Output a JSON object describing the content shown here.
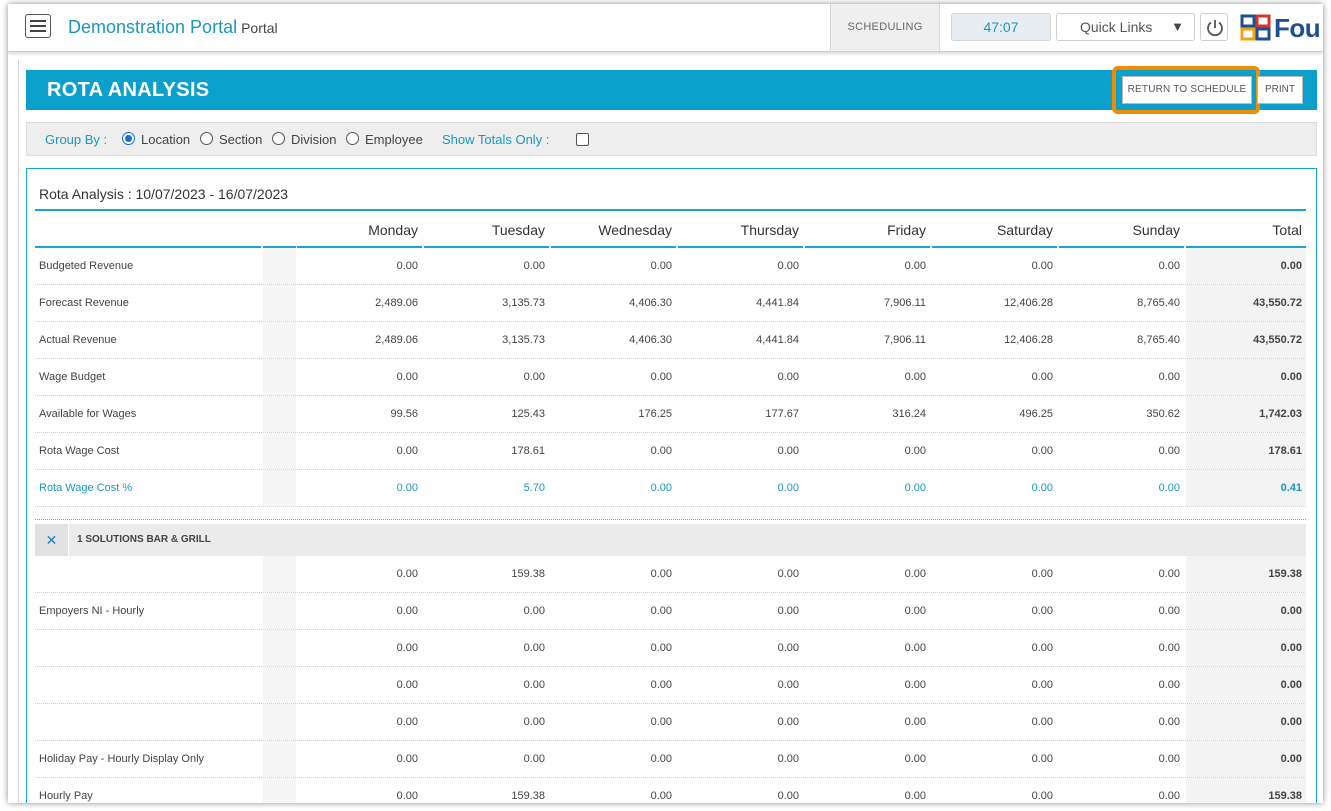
{
  "header": {
    "app_title": "Demonstration Portal",
    "app_subtitle": "Portal",
    "scheduling_tab": "SCHEDULING",
    "timer": "47:07",
    "quick_links": "Quick Links",
    "logo_text": "Fou"
  },
  "page": {
    "title": "ROTA ANALYSIS",
    "return_button": "RETURN TO SCHEDULE",
    "print_button": "PRINT",
    "highlight_color": "#f08c00"
  },
  "groupby": {
    "label": "Group By :",
    "options": [
      "Location",
      "Section",
      "Division",
      "Employee"
    ],
    "selected": "Location",
    "show_totals_label": "Show Totals Only :"
  },
  "report": {
    "title": "Rota Analysis : 10/07/2023 - 16/07/2023",
    "columns": [
      "Monday",
      "Tuesday",
      "Wednesday",
      "Thursday",
      "Friday",
      "Saturday",
      "Sunday",
      "Total"
    ],
    "summary_rows": [
      {
        "label": "Budgeted Revenue",
        "values": [
          "0.00",
          "0.00",
          "0.00",
          "0.00",
          "0.00",
          "0.00",
          "0.00",
          "0.00"
        ]
      },
      {
        "label": "Forecast Revenue",
        "values": [
          "2,489.06",
          "3,135.73",
          "4,406.30",
          "4,441.84",
          "7,906.11",
          "12,406.28",
          "8,765.40",
          "43,550.72"
        ]
      },
      {
        "label": "Actual Revenue",
        "values": [
          "2,489.06",
          "3,135.73",
          "4,406.30",
          "4,441.84",
          "7,906.11",
          "12,406.28",
          "8,765.40",
          "43,550.72"
        ]
      },
      {
        "label": "Wage Budget",
        "values": [
          "0.00",
          "0.00",
          "0.00",
          "0.00",
          "0.00",
          "0.00",
          "0.00",
          "0.00"
        ]
      },
      {
        "label": "Available for Wages",
        "values": [
          "99.56",
          "125.43",
          "176.25",
          "177.67",
          "316.24",
          "496.25",
          "350.62",
          "1,742.03"
        ]
      },
      {
        "label": "Rota Wage Cost",
        "values": [
          "0.00",
          "178.61",
          "0.00",
          "0.00",
          "0.00",
          "0.00",
          "0.00",
          "178.61"
        ]
      },
      {
        "label": "Rota Wage Cost %",
        "values": [
          "0.00",
          "5.70",
          "0.00",
          "0.00",
          "0.00",
          "0.00",
          "0.00",
          "0.41"
        ]
      }
    ],
    "section": {
      "title": "1 SOLUTIONS BAR & GRILL",
      "collapse_glyph": "✕",
      "rows": [
        {
          "label": "",
          "values": [
            "0.00",
            "159.38",
            "0.00",
            "0.00",
            "0.00",
            "0.00",
            "0.00",
            "159.38"
          ]
        },
        {
          "label": "Empoyers NI - Hourly",
          "values": [
            "0.00",
            "0.00",
            "0.00",
            "0.00",
            "0.00",
            "0.00",
            "0.00",
            "0.00"
          ]
        },
        {
          "label": "",
          "values": [
            "0.00",
            "0.00",
            "0.00",
            "0.00",
            "0.00",
            "0.00",
            "0.00",
            "0.00"
          ]
        },
        {
          "label": "",
          "values": [
            "0.00",
            "0.00",
            "0.00",
            "0.00",
            "0.00",
            "0.00",
            "0.00",
            "0.00"
          ]
        },
        {
          "label": "",
          "values": [
            "0.00",
            "0.00",
            "0.00",
            "0.00",
            "0.00",
            "0.00",
            "0.00",
            "0.00"
          ]
        },
        {
          "label": "Holiday Pay - Hourly Display Only",
          "values": [
            "0.00",
            "0.00",
            "0.00",
            "0.00",
            "0.00",
            "0.00",
            "0.00",
            "0.00"
          ]
        },
        {
          "label": "Hourly Pay",
          "values": [
            "0.00",
            "159.38",
            "0.00",
            "0.00",
            "0.00",
            "0.00",
            "0.00",
            "159.38"
          ]
        }
      ]
    }
  }
}
